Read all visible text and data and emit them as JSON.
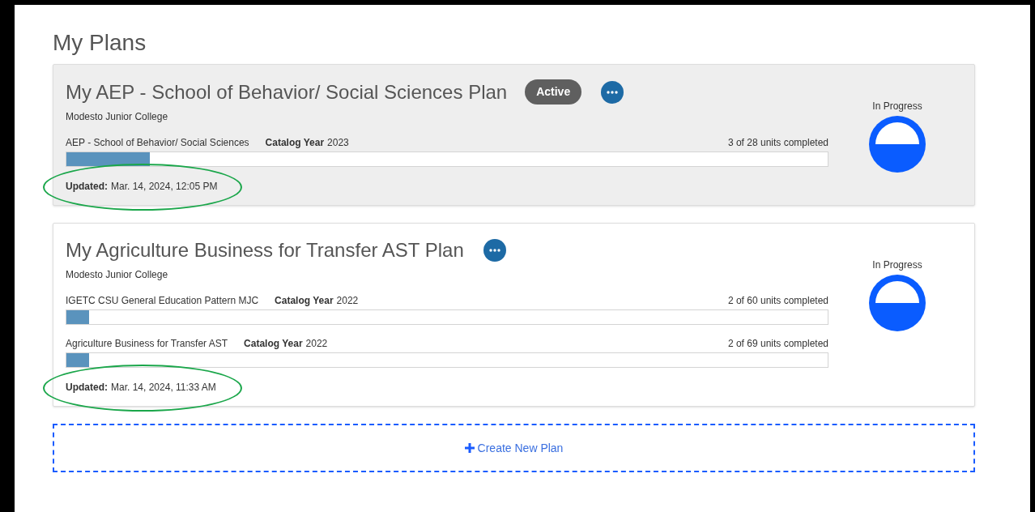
{
  "page": {
    "title": "My Plans"
  },
  "plans": [
    {
      "title": "My AEP - School of Behavior/ Social Sciences Plan",
      "badge": "Active",
      "active": true,
      "school": "Modesto Junior College",
      "status": "In Progress",
      "updated_label": "Updated:",
      "updated": "Mar. 14, 2024, 12:05 PM",
      "circled": true,
      "programs": [
        {
          "name": "AEP - School of Behavior/ Social Sciences",
          "catalog_label": "Catalog Year",
          "catalog_year": "2023",
          "units": "3 of 28 units completed",
          "level": 0.11
        }
      ]
    },
    {
      "title": "My Agriculture Business for Transfer AST Plan",
      "active": false,
      "school": "Modesto Junior College",
      "status": "In Progress",
      "updated_label": "Updated:",
      "updated": "Mar. 14, 2024, 11:33 AM",
      "circled": true,
      "programs": [
        {
          "name": "IGETC CSU General Education Pattern MJC",
          "catalog_label": "Catalog Year",
          "catalog_year": "2022",
          "units": "2 of 60 units completed",
          "level": 0.03
        },
        {
          "name": "Agriculture Business for Transfer AST",
          "catalog_label": "Catalog Year",
          "catalog_year": "2022",
          "units": "2 of 69 units completed",
          "level": 0.03
        }
      ]
    }
  ],
  "create_button": {
    "label": "Create New Plan"
  }
}
